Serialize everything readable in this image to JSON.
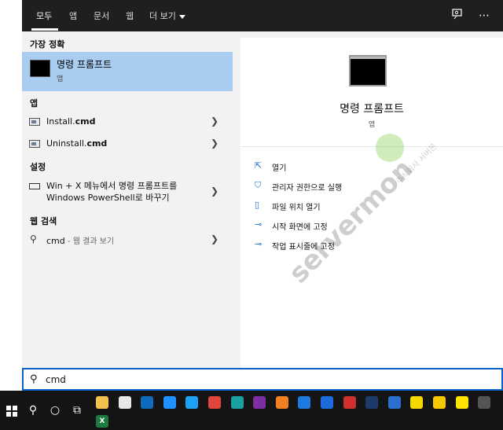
{
  "tabs": [
    {
      "label": "모두"
    },
    {
      "label": "앱"
    },
    {
      "label": "문서"
    },
    {
      "label": "웹"
    },
    {
      "label": "더 보기"
    }
  ],
  "top_icons": [
    "feedback-icon",
    "more-icon"
  ],
  "left": {
    "best_match_title": "가장 정확",
    "best_match": {
      "name": "명령 프롬프트",
      "type": "앱"
    },
    "apps_title": "앱",
    "apps": [
      {
        "prefix": "Install.",
        "bold": "cmd"
      },
      {
        "prefix": "Uninstall.",
        "bold": "cmd"
      }
    ],
    "settings_title": "설정",
    "setting": {
      "line1": "Win + X 메뉴에서 명령 프롬프트를",
      "line2": "Windows PowerShell로 바꾸기"
    },
    "web_title": "웹 검색",
    "web": {
      "query": "cmd",
      "suffix": " - 웹 결과 보기"
    }
  },
  "preview": {
    "title": "명령 프롬프트",
    "subtitle": "앱",
    "actions": [
      {
        "label": "열기",
        "icon": "open-icon"
      },
      {
        "label": "관리자 권한으로 실행",
        "icon": "admin-shield-icon"
      },
      {
        "label": "파일 위치 열기",
        "icon": "file-location-icon"
      },
      {
        "label": "시작 화면에 고정",
        "icon": "pin-icon"
      },
      {
        "label": "작업 표시줄에 고정",
        "icon": "pin-icon"
      }
    ]
  },
  "watermark": {
    "brand": "servermon",
    "tag": "주식회사 서버몬"
  },
  "search": {
    "value": "cmd"
  },
  "taskbar": {
    "apps": [
      {
        "name": "file-explorer-icon",
        "color": "#f2c14e"
      },
      {
        "name": "snip-icon",
        "color": "#e8e8e8"
      },
      {
        "name": "outlook-icon",
        "color": "#0f6cbd"
      },
      {
        "name": "ie-icon",
        "color": "#1e90ff"
      },
      {
        "name": "twitter-icon",
        "color": "#1da1f2"
      },
      {
        "name": "chrome-icon",
        "color": "#e0443a"
      },
      {
        "name": "edge-icon",
        "color": "#1aa0a0"
      },
      {
        "name": "onenote-icon",
        "color": "#7b2fa0"
      },
      {
        "name": "search-tool-icon",
        "color": "#f08020"
      },
      {
        "name": "lp-icon",
        "color": "#1c7ae0"
      },
      {
        "name": "teamviewer-icon",
        "color": "#1e6be0"
      },
      {
        "name": "game-icon",
        "color": "#d03030"
      },
      {
        "name": "a-app-icon",
        "color": "#1c3b6a"
      },
      {
        "name": "shield-app-icon",
        "color": "#2a70d0"
      },
      {
        "name": "sticky-notes-icon",
        "color": "#f5d800"
      },
      {
        "name": "chat-icon",
        "color": "#f5c800"
      },
      {
        "name": "kakaotalk-icon",
        "color": "#ffe400"
      },
      {
        "name": "misc-app-icon",
        "color": "#555555"
      }
    ],
    "excel": {
      "name": "excel-icon",
      "color": "#1f7a3f"
    }
  }
}
